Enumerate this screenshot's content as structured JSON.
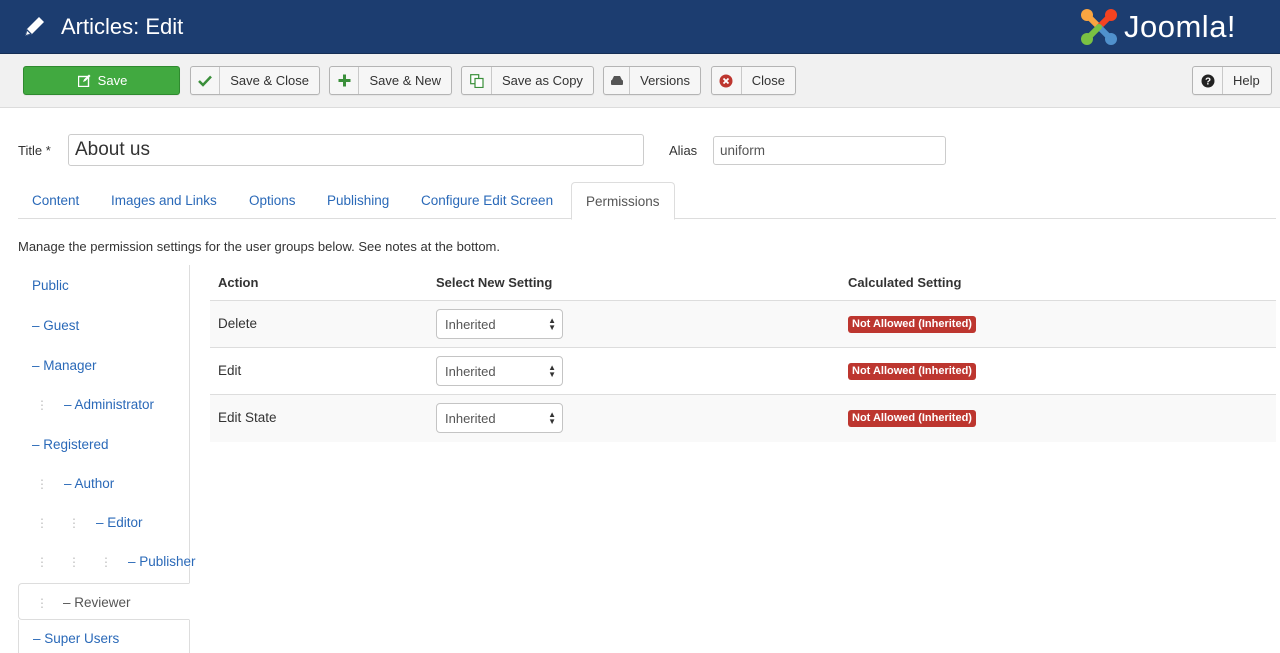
{
  "header": {
    "title": "Articles: Edit",
    "logo_text": "Joomla!",
    "icons": {
      "edit": "pencil-icon",
      "logo": "joomla-logo-icon"
    },
    "colors": {
      "background": "#1c3d70"
    }
  },
  "toolbar": {
    "save": {
      "label": "Save",
      "icon": "edit-icon"
    },
    "save_close": {
      "label": "Save & Close",
      "icon": "check-icon"
    },
    "save_new": {
      "label": "Save & New",
      "icon": "plus-icon"
    },
    "save_copy": {
      "label": "Save as Copy",
      "icon": "copy-icon"
    },
    "versions": {
      "label": "Versions",
      "icon": "archive-icon"
    },
    "close": {
      "label": "Close",
      "icon": "cancel-icon"
    },
    "help": {
      "label": "Help",
      "icon": "question-icon"
    },
    "colors": {
      "save": "#41a940",
      "check": "#3a8f3a",
      "close": "#bd362f"
    }
  },
  "form": {
    "title_label": "Title *",
    "title_value": "About us",
    "alias_label": "Alias",
    "alias_value": "uniform"
  },
  "tabs": [
    {
      "label": "Content"
    },
    {
      "label": "Images and Links"
    },
    {
      "label": "Options"
    },
    {
      "label": "Publishing"
    },
    {
      "label": "Configure Edit Screen"
    },
    {
      "label": "Permissions",
      "active": true
    }
  ],
  "permissions": {
    "intro": "Manage the permission settings for the user groups below. See notes at the bottom.",
    "groups": [
      {
        "label": "Public"
      },
      {
        "label": "– Guest"
      },
      {
        "label": "– Manager"
      },
      {
        "label": "– Administrator"
      },
      {
        "label": "– Registered"
      },
      {
        "label": "– Author"
      },
      {
        "label": "– Editor"
      },
      {
        "label": "– Publisher"
      },
      {
        "label": "– Reviewer",
        "active": true
      },
      {
        "label": "– Super Users"
      }
    ],
    "columns": {
      "action": "Action",
      "new_setting": "Select New Setting",
      "calculated": "Calculated Setting"
    },
    "rows": [
      {
        "action": "Delete",
        "setting": "Inherited",
        "calculated": "Not Allowed (Inherited)"
      },
      {
        "action": "Edit",
        "setting": "Inherited",
        "calculated": "Not Allowed (Inherited)"
      },
      {
        "action": "Edit State",
        "setting": "Inherited",
        "calculated": "Not Allowed (Inherited)"
      }
    ],
    "colors": {
      "not_allowed": "#bd362f",
      "link": "#2a69b8"
    }
  }
}
